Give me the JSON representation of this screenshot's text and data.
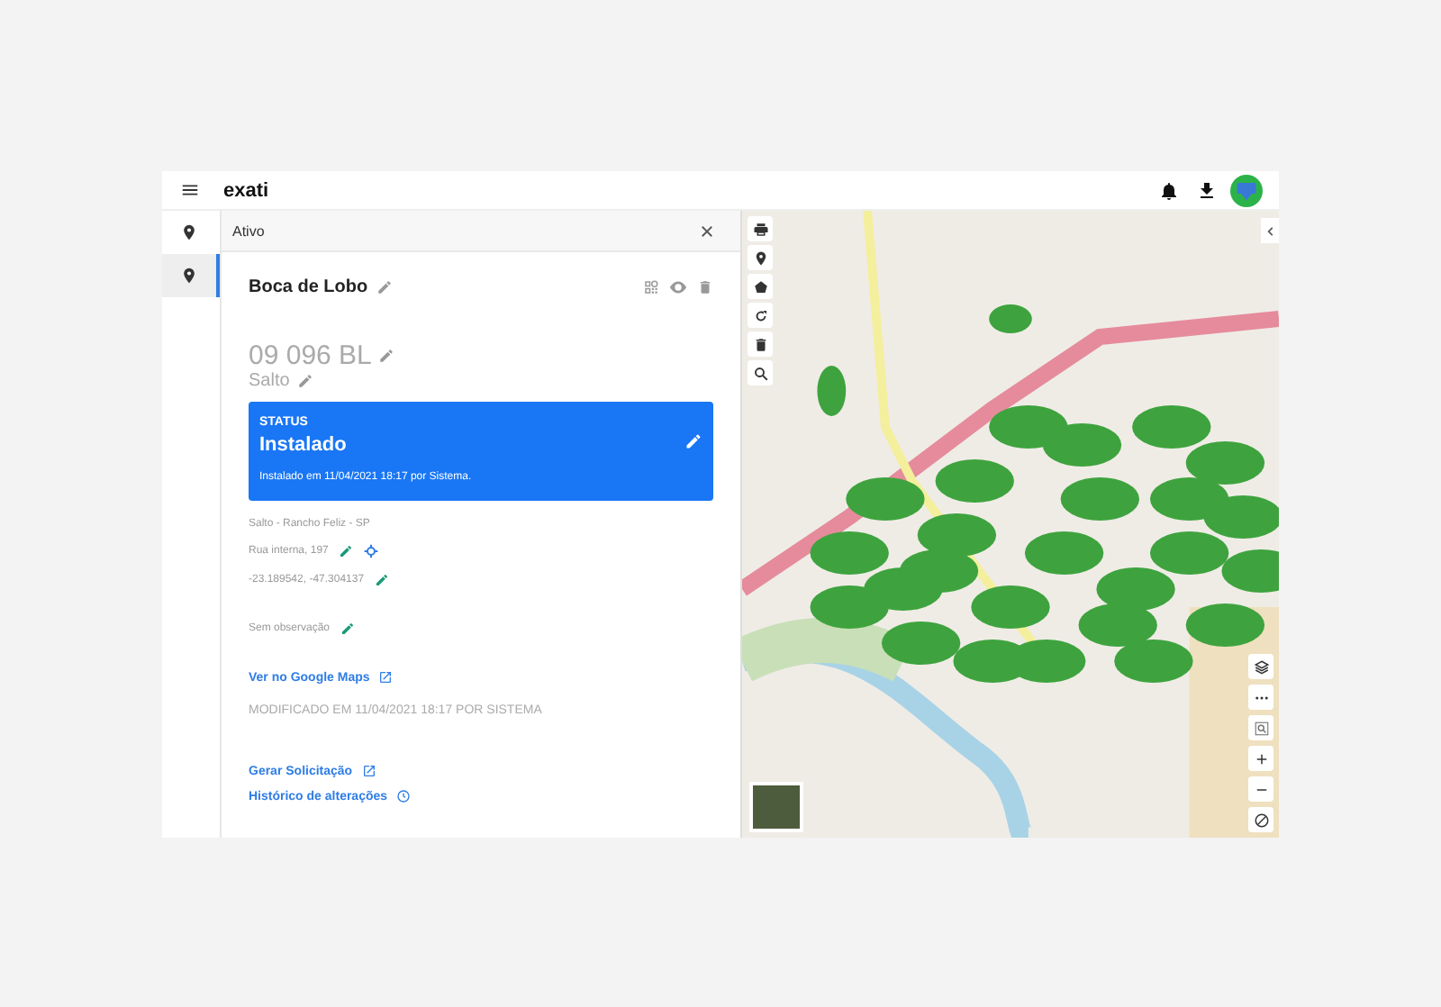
{
  "header": {
    "logo": "exati"
  },
  "rail": [
    {
      "kind": "marker",
      "selected": false
    },
    {
      "kind": "marker-gear",
      "selected": true
    }
  ],
  "panel": {
    "title": "Ativo",
    "asset_name": "Boca de Lobo",
    "code": "09 096 BL",
    "city": "Salto",
    "status": {
      "label": "STATUS",
      "value": "Instalado",
      "detail": "Instalado em 11/04/2021 18:17 por Sistema."
    },
    "region": "Salto - Rancho Feliz - SP",
    "details": [
      {
        "text": "Rua interna, 197",
        "editable": true,
        "locate": true
      },
      {
        "text": "-23.189542, -47.304137",
        "editable": true,
        "locate": false
      }
    ],
    "observation": {
      "text": "Sem observação",
      "editable": true
    },
    "maps_link": "Ver no Google Maps",
    "modified": "MODIFICADO EM 11/04/2021 18:17 POR SISTEMA",
    "actions": [
      {
        "label": "Gerar Solicitação",
        "kind": "external"
      },
      {
        "label": "Histórico de alterações",
        "kind": "history"
      }
    ]
  }
}
